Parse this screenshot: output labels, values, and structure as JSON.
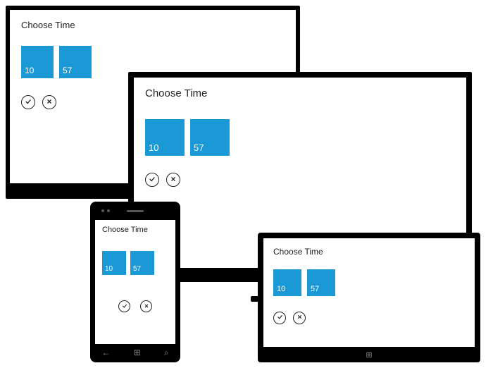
{
  "picker": {
    "title": "Choose Time",
    "hour": "10",
    "minute": "57"
  },
  "icons": {
    "accept": "check-icon",
    "cancel": "x-icon"
  }
}
